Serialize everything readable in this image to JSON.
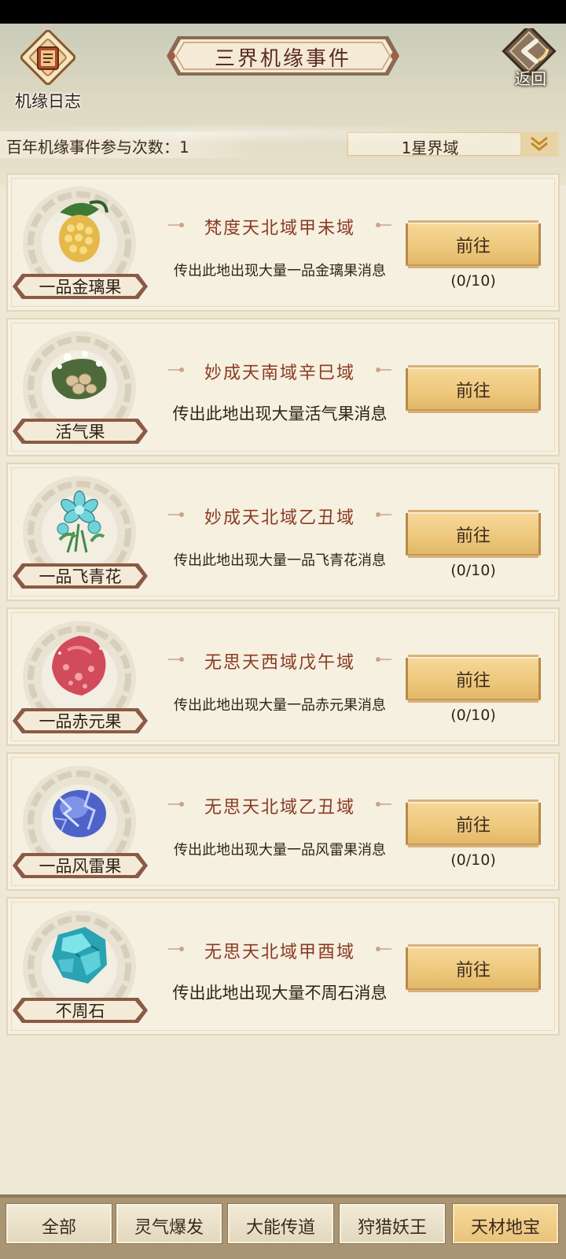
{
  "header": {
    "log_label": "机缘日志",
    "title": "三界机缘事件",
    "back_label": "返回",
    "participation": "百年机缘事件参与次数：1",
    "domain_select": "1星界域"
  },
  "events": [
    {
      "item": "一品金璃果",
      "location": "梵度天北域甲未域",
      "message": "传出此地出现大量一品金璃果消息",
      "button": "前往",
      "progress": "(0/10)"
    },
    {
      "item": "活气果",
      "location": "妙成天南域辛巳域",
      "message": "传出此地出现大量活气果消息",
      "button": "前往",
      "progress": ""
    },
    {
      "item": "一品飞青花",
      "location": "妙成天北域乙丑域",
      "message": "传出此地出现大量一品飞青花消息",
      "button": "前往",
      "progress": "(0/10)"
    },
    {
      "item": "一品赤元果",
      "location": "无思天西域戊午域",
      "message": "传出此地出现大量一品赤元果消息",
      "button": "前往",
      "progress": "(0/10)"
    },
    {
      "item": "一品风雷果",
      "location": "无思天北域乙丑域",
      "message": "传出此地出现大量一品风雷果消息",
      "button": "前往",
      "progress": "(0/10)"
    },
    {
      "item": "不周石",
      "location": "无思天北域甲酉域",
      "message": "传出此地出现大量不周石消息",
      "button": "前往",
      "progress": ""
    }
  ],
  "tabs": [
    {
      "label": "全部",
      "active": false
    },
    {
      "label": "灵气爆发",
      "active": false
    },
    {
      "label": "大能传道",
      "active": false
    },
    {
      "label": "狩猎妖王",
      "active": false
    },
    {
      "label": "天材地宝",
      "active": true
    }
  ],
  "icons": [
    "scroll-log-icon",
    "back-arrow-icon",
    "chevron-down-icon",
    "golden-fruit-icon",
    "vital-fruit-icon",
    "cyan-flower-icon",
    "red-fruit-icon",
    "thunder-fruit-icon",
    "buzhou-stone-icon"
  ]
}
